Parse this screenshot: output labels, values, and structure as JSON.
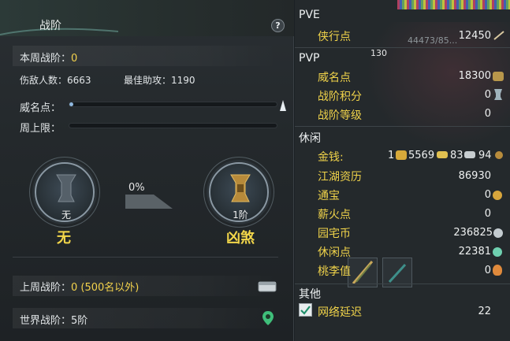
{
  "left_panel": {
    "title": "战阶",
    "help_label": "?",
    "weekly_rank_label": "本周战阶：",
    "weekly_rank_value": "0",
    "damage_count_label": "伤敌人数：",
    "damage_count_value": "6663",
    "best_assist_label": "最佳助攻：",
    "best_assist_value": "1190",
    "reputation_label": "威名点：",
    "reputation_progress": 0.02,
    "weekly_cap_label": "周上限：",
    "weekly_cap_progress": 0.0,
    "progress_percent": "0%",
    "current_tier_small": "无",
    "current_tier_name": "无",
    "next_tier_small": "1阶",
    "next_tier_name": "凶煞",
    "last_week_label": "上周战阶：",
    "last_week_value": "0 (500名以外)",
    "world_rank_label": "世界战阶：",
    "world_rank_value": "5阶"
  },
  "right_panel": {
    "pve": {
      "header": "PVE",
      "items": [
        {
          "label": "侠行点",
          "value": "12450"
        }
      ],
      "overlay_text": "44473/85..."
    },
    "pvp": {
      "header": "PVP",
      "badge": "130",
      "items": [
        {
          "label": "威名点",
          "value": "18300"
        },
        {
          "label": "战阶积分",
          "value": "0"
        },
        {
          "label": "战阶等级",
          "value": "0"
        }
      ]
    },
    "leisure": {
      "header": "休闲",
      "money_label": "金钱:",
      "money_values": [
        "1",
        "5569",
        "83",
        "94"
      ],
      "items": [
        {
          "label": "江湖资历",
          "value": "86930"
        },
        {
          "label": "通宝",
          "value": "0"
        },
        {
          "label": "薪火点",
          "value": "0"
        },
        {
          "label": "园宅币",
          "value": "236825"
        },
        {
          "label": "休闲点",
          "value": "22381"
        },
        {
          "label": "桃李值",
          "value": "0"
        }
      ]
    },
    "other": {
      "header": "其他",
      "latency_label": "网络延迟",
      "latency_value": "22"
    }
  },
  "colors": {
    "accent_yellow": "#f3d24c",
    "panel_bg": "#24292c",
    "bar_fill": "#8fb8e0"
  }
}
